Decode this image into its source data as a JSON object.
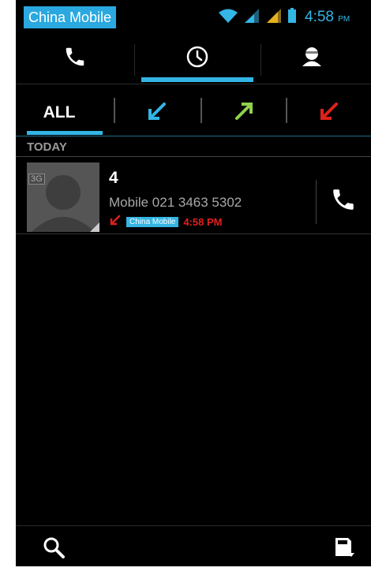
{
  "status_bar": {
    "carrier": "China Mobile",
    "time": "4:58",
    "time_suffix": "PM"
  },
  "main_tabs": [
    {
      "icon": "phone-icon",
      "active": false
    },
    {
      "icon": "clock-icon",
      "active": true
    },
    {
      "icon": "contacts-icon",
      "active": false
    }
  ],
  "filter_tabs": {
    "all_label": "ALL",
    "items": [
      {
        "icon": "incoming-call-icon",
        "color": "#33b5e5"
      },
      {
        "icon": "outgoing-call-icon",
        "color": "#8fd14f"
      },
      {
        "icon": "missed-call-icon",
        "color": "#e0201a"
      }
    ]
  },
  "section_title": "TODAY",
  "calls": [
    {
      "name": "4",
      "number_line": "Mobile 021 3463 5302",
      "network_badge": "3G",
      "sim_label": "China Mobile",
      "time": "4:58 PM",
      "type_icon": "missed-call-icon"
    }
  ],
  "colors": {
    "accent": "#33b5e5",
    "missed": "#e0201a",
    "outgoing": "#8fd14f"
  }
}
